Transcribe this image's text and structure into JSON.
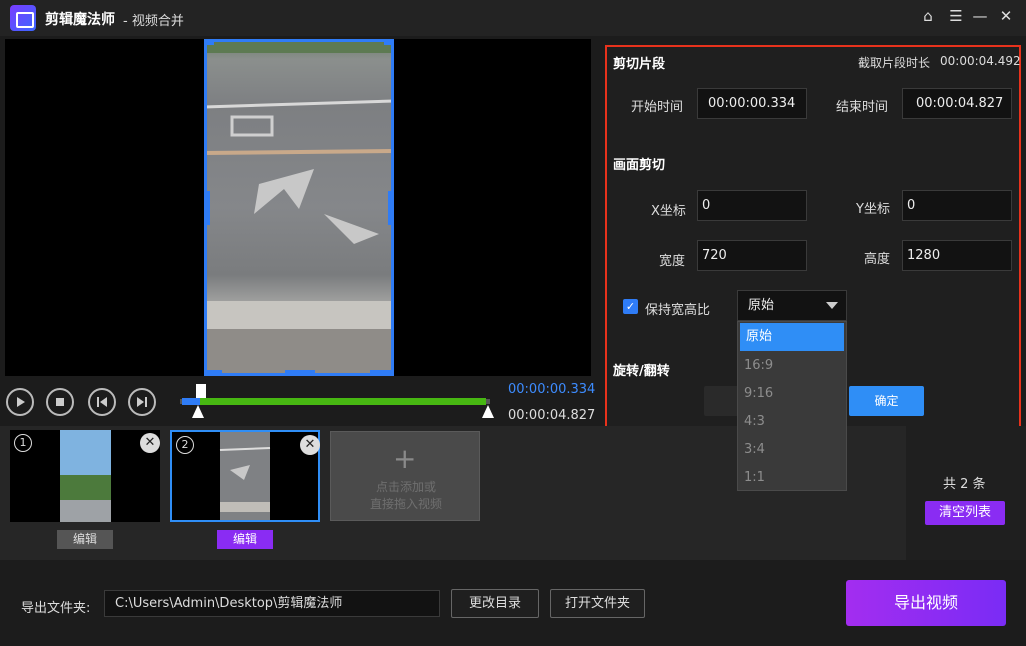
{
  "titlebar": {
    "app_name": "剪辑魔法师",
    "subtitle": "- 视频合并"
  },
  "player": {
    "time_start": "00:00:00.334",
    "time_end": "00:00:04.827"
  },
  "panel": {
    "cut_title": "剪切片段",
    "duration_label": "截取片段时长",
    "duration_value": "00:00:04.492",
    "start_label": "开始时间",
    "start_value": "00:00:00.334",
    "end_label": "结束时间",
    "end_value": "00:00:04.827",
    "crop_title": "画面剪切",
    "x_label": "X坐标",
    "x_value": "0",
    "y_label": "Y坐标",
    "y_value": "0",
    "width_label": "宽度",
    "width_value": "720",
    "height_label": "高度",
    "height_value": "1280",
    "keep_ratio_label": "保持宽高比",
    "ratio_selected": "原始",
    "ratio_options": [
      "原始",
      "16:9",
      "9:16",
      "4:3",
      "3:4",
      "1:1"
    ],
    "rotate_title": "旋转/翻转",
    "confirm_label": "确定"
  },
  "clips": {
    "items": [
      {
        "number": "1",
        "edit_label": "编辑"
      },
      {
        "number": "2",
        "edit_label": "编辑"
      }
    ],
    "add_line1": "点击添加或",
    "add_line2": "直接拖入视频",
    "count_text": "共 2 条",
    "clear_label": "清空列表"
  },
  "export": {
    "folder_label": "导出文件夹:",
    "folder_path": "C:\\Users\\Admin\\Desktop\\剪辑魔法师",
    "change_dir_label": "更改目录",
    "open_folder_label": "打开文件夹",
    "export_label": "导出视频"
  },
  "colors": {
    "accent": "#2f8ef6",
    "purple": "#8a2cf3",
    "highlight_border": "#e8321c",
    "track": "#47b712"
  }
}
